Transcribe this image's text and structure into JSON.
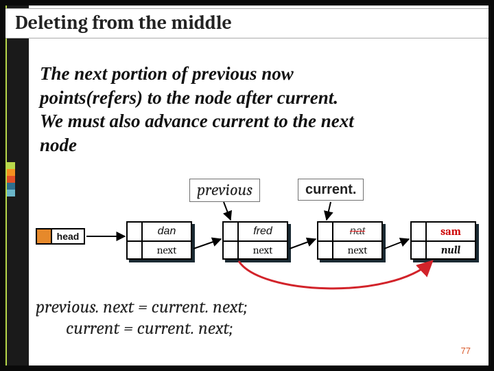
{
  "title": "Deleting from the middle",
  "body_text": "The next portion of previous now points(refers) to the node after   current.  We must also advance current to the next node",
  "pointers": {
    "previous": "previous",
    "current": "current."
  },
  "head_label": "head",
  "nodes": [
    {
      "name": "dan",
      "next": "next"
    },
    {
      "name": "fred",
      "next": "next"
    },
    {
      "name": "nat",
      "next": "next"
    },
    {
      "name": "sam",
      "next": "null"
    }
  ],
  "code": {
    "line1": "previous. next = current. next;",
    "line2": "current = current. next;"
  },
  "page_number": "77"
}
